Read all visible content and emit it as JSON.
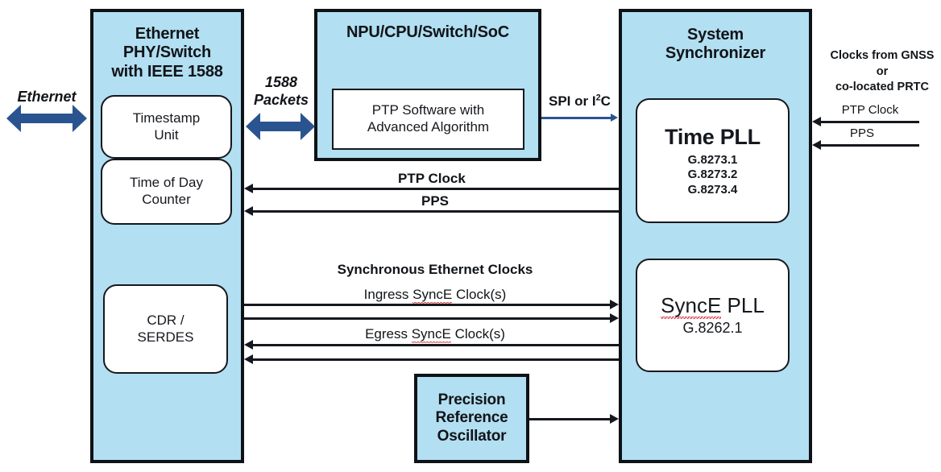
{
  "diagram": {
    "title": "IEEE 1588 / SyncE system synchronization block diagram",
    "colors": {
      "block_fill": "#b2dff1",
      "block_border": "#0e1116",
      "inner_fill": "#ffffff",
      "arrow_black": "#15181d",
      "arrow_blue": "#2a5490",
      "spellcheck_red": "#d4202a"
    }
  },
  "blocks": {
    "phy": {
      "title": "Ethernet\nPHY/Switch\nwith IEEE 1588",
      "title_lines": [
        "Ethernet",
        "PHY/Switch",
        "with IEEE 1588"
      ],
      "inner": [
        {
          "name": "timestamp-unit",
          "label": "Timestamp\nUnit",
          "lines": [
            "Timestamp",
            "Unit"
          ]
        },
        {
          "name": "time-of-day-counter",
          "label": "Time of Day\nCounter",
          "lines": [
            "Time of Day",
            "Counter"
          ]
        },
        {
          "name": "cdr-serdes",
          "label": "CDR /\nSERDES",
          "lines": [
            "CDR /",
            "SERDES"
          ]
        }
      ]
    },
    "npu": {
      "title": "NPU/CPU/Switch/SoC",
      "inner": [
        {
          "name": "ptp-software",
          "label": "PTP Software with\nAdvanced Algorithm",
          "lines": [
            "PTP Software with",
            "Advanced Algorithm"
          ]
        }
      ]
    },
    "sync": {
      "title": "System\nSynchronizer",
      "title_lines": [
        "System",
        "Synchronizer"
      ],
      "inner": [
        {
          "name": "time-pll",
          "heading": "Time PLL",
          "standards": [
            "G.8273.1",
            "G.8273.2",
            "G.8273.4"
          ]
        },
        {
          "name": "synce-pll",
          "heading": "SyncE PLL",
          "heading_misspelled_part": "SyncE",
          "standards": [
            "G.8262.1"
          ]
        }
      ]
    },
    "oscillator": {
      "title": "Precision\nReference\nOscillator",
      "title_lines": [
        "Precision",
        "Reference",
        "Oscillator"
      ]
    }
  },
  "connections": {
    "ethernet": {
      "label": "Ethernet",
      "style": "bold-italic",
      "direction": "bidirectional",
      "color": "#2a5490"
    },
    "packets_1588": {
      "label": "1588\nPackets",
      "lines": [
        "1588",
        "Packets"
      ],
      "style": "bold-italic",
      "direction": "bidirectional",
      "color": "#2a5490"
    },
    "spi_i2c": {
      "label": "SPI or I2C",
      "label_html": "SPI or I²C",
      "style": "bold",
      "direction": "right",
      "color": "#2a5490"
    },
    "ptp_clock_down": {
      "label": "PTP Clock",
      "style": "bold",
      "direction": "left"
    },
    "pps_down": {
      "label": "PPS",
      "style": "bold",
      "direction": "left"
    },
    "synce_group_title": {
      "label": "Synchronous Ethernet Clocks",
      "style": "bold"
    },
    "ingress_synce": {
      "label": "Ingress SyncE Clock(s)",
      "style": "regular",
      "direction": "right",
      "count": 2
    },
    "egress_synce": {
      "label": "Egress SyncE Clock(s)",
      "style": "regular",
      "direction": "left",
      "count": 2
    },
    "oscillator_to_sync": {
      "label": "",
      "direction": "right"
    },
    "external": {
      "source_label_lines": [
        "Clocks from GNSS",
        "or",
        "co-located PRTC"
      ],
      "inputs": [
        {
          "label": "PTP Clock",
          "style": "regular",
          "direction": "left"
        },
        {
          "label": "PPS",
          "style": "regular",
          "direction": "left"
        }
      ]
    }
  }
}
